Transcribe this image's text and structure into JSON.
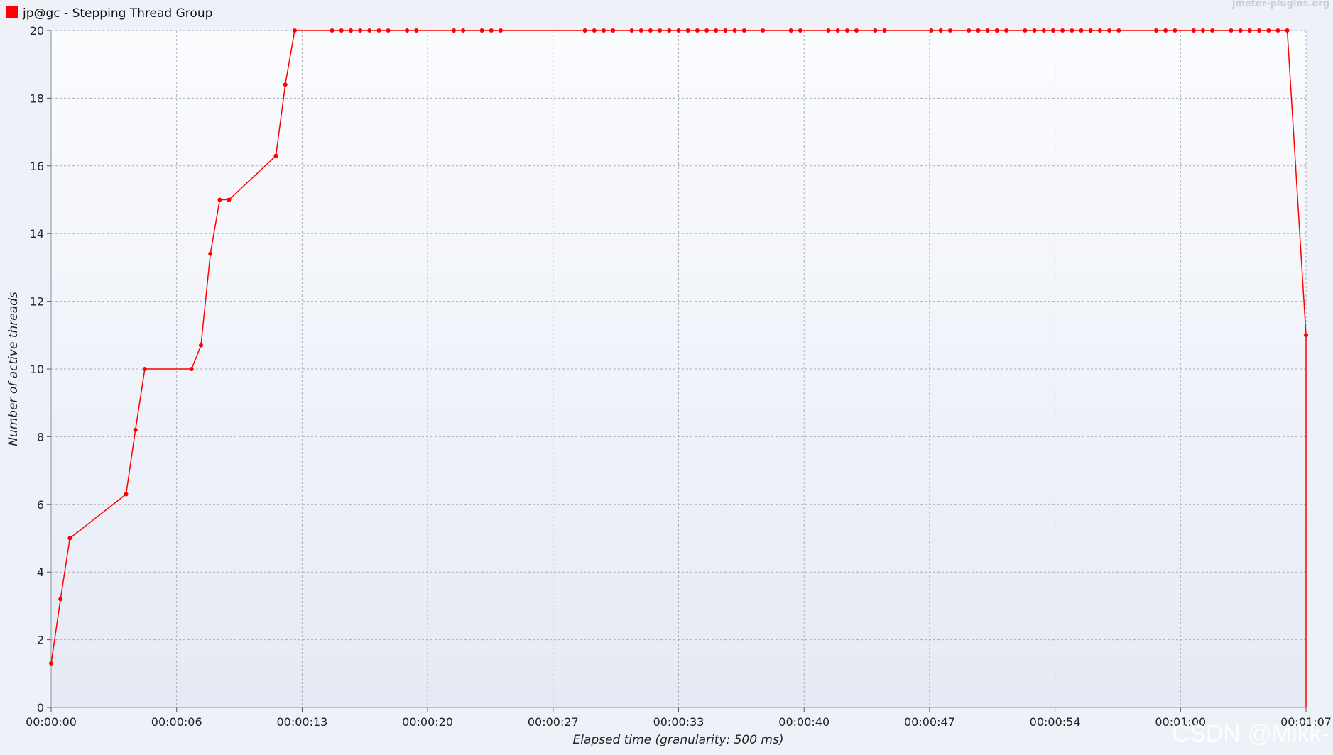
{
  "legend": {
    "label": "jp@gc - Stepping Thread Group",
    "color": "#ff0000"
  },
  "brand": "jmeter-plugins.org",
  "watermark": "CSDN @Mikk-",
  "chart_data": {
    "type": "line",
    "xlabel": "Elapsed time (granularity: 500 ms)",
    "ylabel": "Number of active threads",
    "xlim": [
      0,
      67
    ],
    "ylim": [
      0,
      20
    ],
    "x_ticks": [
      "00:00:00",
      "00:00:06",
      "00:00:13",
      "00:00:20",
      "00:00:27",
      "00:00:33",
      "00:00:40",
      "00:00:47",
      "00:00:54",
      "00:01:00",
      "00:01:07"
    ],
    "y_ticks": [
      0,
      2,
      4,
      6,
      8,
      10,
      12,
      14,
      16,
      18,
      20
    ],
    "grid": true,
    "legend_position": "top-left",
    "series": [
      {
        "name": "jp@gc - Stepping Thread Group",
        "color": "#ff0000",
        "x": [
          0,
          0.5,
          1,
          4,
          4.5,
          5,
          7.5,
          8,
          8.5,
          9,
          9.5,
          12,
          12.5,
          13,
          15,
          15.5,
          16,
          16.5,
          17,
          17.5,
          18,
          19,
          19.5,
          21.5,
          22,
          23,
          23.5,
          24,
          28.5,
          29,
          29.5,
          30,
          31,
          31.5,
          32,
          32.5,
          33,
          33.5,
          34,
          34.5,
          35,
          35.5,
          36,
          36.5,
          37,
          38,
          39.5,
          40,
          41.5,
          42,
          42.5,
          43,
          44,
          44.5,
          47,
          47.5,
          48,
          49,
          49.5,
          50,
          50.5,
          51,
          52,
          52.5,
          53,
          53.5,
          54,
          54.5,
          55,
          55.5,
          56,
          56.5,
          57,
          59,
          59.5,
          60,
          61,
          61.5,
          62,
          63,
          63.5,
          64,
          64.5,
          65,
          65.5,
          66,
          67,
          67
        ],
        "values": [
          1.3,
          3.2,
          5,
          6.3,
          8.2,
          10,
          10,
          10.7,
          13.4,
          15,
          15,
          16.3,
          18.4,
          20,
          20,
          20,
          20,
          20,
          20,
          20,
          20,
          20,
          20,
          20,
          20,
          20,
          20,
          20,
          20,
          20,
          20,
          20,
          20,
          20,
          20,
          20,
          20,
          20,
          20,
          20,
          20,
          20,
          20,
          20,
          20,
          20,
          20,
          20,
          20,
          20,
          20,
          20,
          20,
          20,
          20,
          20,
          20,
          20,
          20,
          20,
          20,
          20,
          20,
          20,
          20,
          20,
          20,
          20,
          20,
          20,
          20,
          20,
          20,
          20,
          20,
          20,
          20,
          20,
          20,
          20,
          20,
          20,
          20,
          20,
          20,
          20,
          11,
          0
        ]
      }
    ]
  }
}
